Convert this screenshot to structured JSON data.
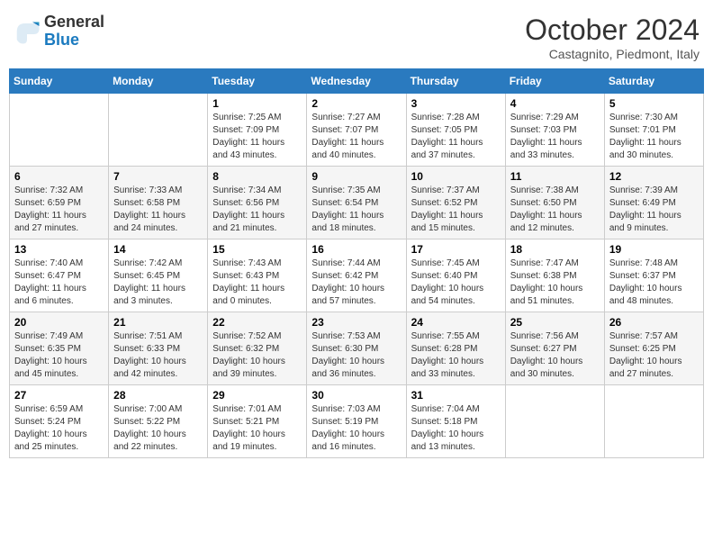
{
  "header": {
    "logo": {
      "general": "General",
      "blue": "Blue"
    },
    "title": "October 2024",
    "subtitle": "Castagnito, Piedmont, Italy"
  },
  "weekdays": [
    "Sunday",
    "Monday",
    "Tuesday",
    "Wednesday",
    "Thursday",
    "Friday",
    "Saturday"
  ],
  "weeks": [
    [
      null,
      null,
      {
        "day": 1,
        "sunrise": "7:25 AM",
        "sunset": "7:09 PM",
        "daylight": "11 hours and 43 minutes."
      },
      {
        "day": 2,
        "sunrise": "7:27 AM",
        "sunset": "7:07 PM",
        "daylight": "11 hours and 40 minutes."
      },
      {
        "day": 3,
        "sunrise": "7:28 AM",
        "sunset": "7:05 PM",
        "daylight": "11 hours and 37 minutes."
      },
      {
        "day": 4,
        "sunrise": "7:29 AM",
        "sunset": "7:03 PM",
        "daylight": "11 hours and 33 minutes."
      },
      {
        "day": 5,
        "sunrise": "7:30 AM",
        "sunset": "7:01 PM",
        "daylight": "11 hours and 30 minutes."
      }
    ],
    [
      {
        "day": 6,
        "sunrise": "7:32 AM",
        "sunset": "6:59 PM",
        "daylight": "11 hours and 27 minutes."
      },
      {
        "day": 7,
        "sunrise": "7:33 AM",
        "sunset": "6:58 PM",
        "daylight": "11 hours and 24 minutes."
      },
      {
        "day": 8,
        "sunrise": "7:34 AM",
        "sunset": "6:56 PM",
        "daylight": "11 hours and 21 minutes."
      },
      {
        "day": 9,
        "sunrise": "7:35 AM",
        "sunset": "6:54 PM",
        "daylight": "11 hours and 18 minutes."
      },
      {
        "day": 10,
        "sunrise": "7:37 AM",
        "sunset": "6:52 PM",
        "daylight": "11 hours and 15 minutes."
      },
      {
        "day": 11,
        "sunrise": "7:38 AM",
        "sunset": "6:50 PM",
        "daylight": "11 hours and 12 minutes."
      },
      {
        "day": 12,
        "sunrise": "7:39 AM",
        "sunset": "6:49 PM",
        "daylight": "11 hours and 9 minutes."
      }
    ],
    [
      {
        "day": 13,
        "sunrise": "7:40 AM",
        "sunset": "6:47 PM",
        "daylight": "11 hours and 6 minutes."
      },
      {
        "day": 14,
        "sunrise": "7:42 AM",
        "sunset": "6:45 PM",
        "daylight": "11 hours and 3 minutes."
      },
      {
        "day": 15,
        "sunrise": "7:43 AM",
        "sunset": "6:43 PM",
        "daylight": "11 hours and 0 minutes."
      },
      {
        "day": 16,
        "sunrise": "7:44 AM",
        "sunset": "6:42 PM",
        "daylight": "10 hours and 57 minutes."
      },
      {
        "day": 17,
        "sunrise": "7:45 AM",
        "sunset": "6:40 PM",
        "daylight": "10 hours and 54 minutes."
      },
      {
        "day": 18,
        "sunrise": "7:47 AM",
        "sunset": "6:38 PM",
        "daylight": "10 hours and 51 minutes."
      },
      {
        "day": 19,
        "sunrise": "7:48 AM",
        "sunset": "6:37 PM",
        "daylight": "10 hours and 48 minutes."
      }
    ],
    [
      {
        "day": 20,
        "sunrise": "7:49 AM",
        "sunset": "6:35 PM",
        "daylight": "10 hours and 45 minutes."
      },
      {
        "day": 21,
        "sunrise": "7:51 AM",
        "sunset": "6:33 PM",
        "daylight": "10 hours and 42 minutes."
      },
      {
        "day": 22,
        "sunrise": "7:52 AM",
        "sunset": "6:32 PM",
        "daylight": "10 hours and 39 minutes."
      },
      {
        "day": 23,
        "sunrise": "7:53 AM",
        "sunset": "6:30 PM",
        "daylight": "10 hours and 36 minutes."
      },
      {
        "day": 24,
        "sunrise": "7:55 AM",
        "sunset": "6:28 PM",
        "daylight": "10 hours and 33 minutes."
      },
      {
        "day": 25,
        "sunrise": "7:56 AM",
        "sunset": "6:27 PM",
        "daylight": "10 hours and 30 minutes."
      },
      {
        "day": 26,
        "sunrise": "7:57 AM",
        "sunset": "6:25 PM",
        "daylight": "10 hours and 27 minutes."
      }
    ],
    [
      {
        "day": 27,
        "sunrise": "6:59 AM",
        "sunset": "5:24 PM",
        "daylight": "10 hours and 25 minutes."
      },
      {
        "day": 28,
        "sunrise": "7:00 AM",
        "sunset": "5:22 PM",
        "daylight": "10 hours and 22 minutes."
      },
      {
        "day": 29,
        "sunrise": "7:01 AM",
        "sunset": "5:21 PM",
        "daylight": "10 hours and 19 minutes."
      },
      {
        "day": 30,
        "sunrise": "7:03 AM",
        "sunset": "5:19 PM",
        "daylight": "10 hours and 16 minutes."
      },
      {
        "day": 31,
        "sunrise": "7:04 AM",
        "sunset": "5:18 PM",
        "daylight": "10 hours and 13 minutes."
      },
      null,
      null
    ]
  ]
}
